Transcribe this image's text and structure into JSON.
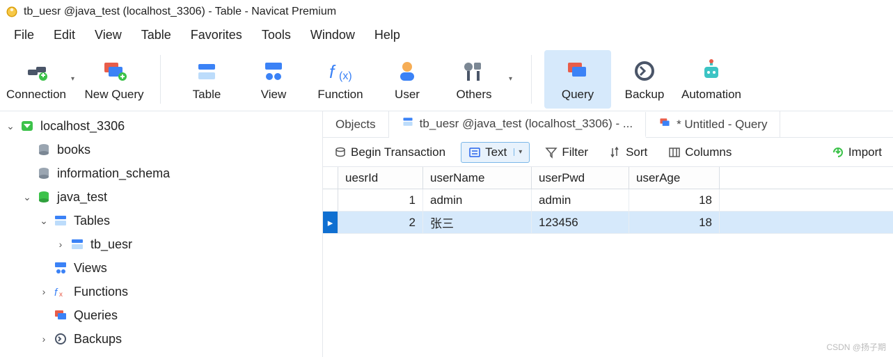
{
  "window": {
    "title": "tb_uesr @java_test (localhost_3306) - Table - Navicat Premium"
  },
  "menubar": [
    "File",
    "Edit",
    "View",
    "Table",
    "Favorites",
    "Tools",
    "Window",
    "Help"
  ],
  "toolbar": [
    {
      "id": "connection",
      "label": "Connection",
      "dropdown": true
    },
    {
      "id": "new-query",
      "label": "New Query"
    },
    {
      "id": "sep"
    },
    {
      "id": "table",
      "label": "Table"
    },
    {
      "id": "view",
      "label": "View"
    },
    {
      "id": "function",
      "label": "Function"
    },
    {
      "id": "user",
      "label": "User"
    },
    {
      "id": "others",
      "label": "Others",
      "dropdown": true
    },
    {
      "id": "sep"
    },
    {
      "id": "query",
      "label": "Query",
      "active": true
    },
    {
      "id": "backup",
      "label": "Backup"
    },
    {
      "id": "automation",
      "label": "Automation"
    }
  ],
  "tree": {
    "conn": "localhost_3306",
    "dbs": [
      "books",
      "information_schema"
    ],
    "active_db": "java_test",
    "tables_label": "Tables",
    "table_item": "tb_uesr",
    "views_label": "Views",
    "functions_label": "Functions",
    "queries_label": "Queries",
    "backups_label": "Backups"
  },
  "tabs": {
    "objects": "Objects",
    "table_tab": "tb_uesr @java_test (localhost_3306) - ...",
    "query_tab": "* Untitled - Query"
  },
  "subtoolbar": {
    "begin": "Begin Transaction",
    "text": "Text",
    "filter": "Filter",
    "sort": "Sort",
    "columns": "Columns",
    "import": "Import"
  },
  "grid": {
    "columns": [
      "uesrId",
      "userName",
      "userPwd",
      "userAge"
    ],
    "rows": [
      {
        "uesrId": "1",
        "userName": "admin",
        "userPwd": "admin",
        "userAge": "18",
        "selected": false
      },
      {
        "uesrId": "2",
        "userName": "张三",
        "userPwd": "123456",
        "userAge": "18",
        "selected": true
      }
    ]
  },
  "watermark": "CSDN @扬子期"
}
